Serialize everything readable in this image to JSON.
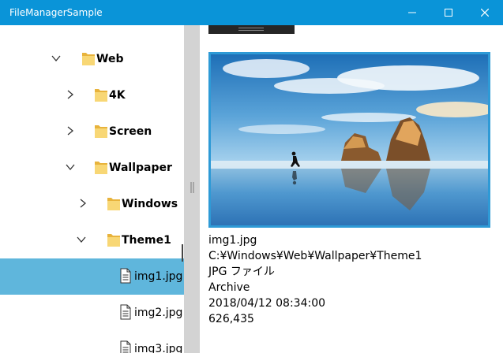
{
  "window": {
    "title": "FileManagerSample",
    "controls": [
      "minimize-icon",
      "maximize-icon",
      "close-icon"
    ],
    "title_bar_color": "#0a94d8"
  },
  "tree": {
    "items": [
      {
        "label": "Web",
        "type": "folder",
        "expanded": true,
        "level": 1
      },
      {
        "label": "4K",
        "type": "folder",
        "expanded": false,
        "level": 2
      },
      {
        "label": "Screen",
        "type": "folder",
        "expanded": false,
        "level": 2
      },
      {
        "label": "Wallpaper",
        "type": "folder",
        "expanded": true,
        "level": 2
      },
      {
        "label": "Windows",
        "type": "folder",
        "expanded": false,
        "level": 3
      },
      {
        "label": "Theme1",
        "type": "folder",
        "expanded": true,
        "level": 3
      },
      {
        "label": "img1.jpg",
        "type": "file",
        "selected": true,
        "level": 4
      },
      {
        "label": "img2.jpg",
        "type": "file",
        "selected": false,
        "level": 4
      },
      {
        "label": "img3.jpg",
        "type": "file",
        "selected": false,
        "level": 4
      }
    ],
    "selected_color": "#5fb6dc",
    "folder_color": "#f0c14e"
  },
  "details": {
    "name": "img1.jpg",
    "path": "C:¥Windows¥Web¥Wallpaper¥Theme1",
    "file_type": "JPG ファイル",
    "attributes": "Archive",
    "date": "2018/04/12 08:34:00",
    "size": "626,435",
    "preview_border_color": "#2e9ad6"
  }
}
